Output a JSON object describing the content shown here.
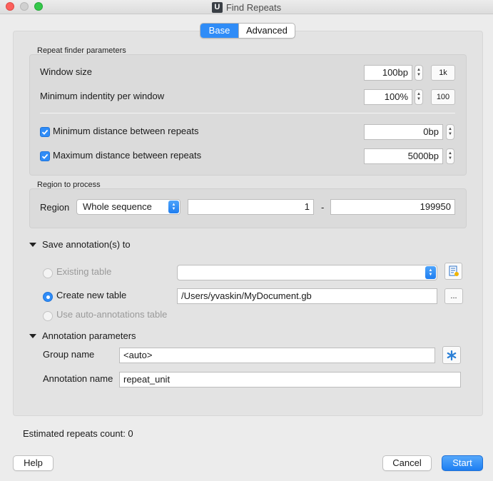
{
  "window": {
    "title": "Find Repeats",
    "app_icon_letter": "U"
  },
  "tabs": [
    {
      "label": "Base",
      "active": true
    },
    {
      "label": "Advanced",
      "active": false
    }
  ],
  "repeat_finder": {
    "group_title": "Repeat finder parameters",
    "window_size": {
      "label": "Window size",
      "value": "100bp",
      "button": "1k"
    },
    "min_identity": {
      "label": "Minimum indentity per window",
      "value": "100%",
      "button": "100"
    },
    "min_distance": {
      "label": "Minimum distance between repeats",
      "checked": true,
      "value": "0bp"
    },
    "max_distance": {
      "label": "Maximum distance between repeats",
      "checked": true,
      "value": "5000bp"
    }
  },
  "region": {
    "group_title": "Region to process",
    "label": "Region",
    "selection": "Whole sequence",
    "start": "1",
    "separator": "-",
    "end": "199950"
  },
  "save_annotations": {
    "header": "Save annotation(s) to",
    "existing_table": {
      "label": "Existing table",
      "value": ""
    },
    "create_new_table": {
      "label": "Create new table",
      "value": "/Users/yvaskin/MyDocument.gb",
      "browse": "..."
    },
    "auto_annotations": {
      "label": "Use auto-annotations table"
    }
  },
  "annotation_params": {
    "header": "Annotation parameters",
    "group_name": {
      "label": "Group name",
      "value": "<auto>"
    },
    "annotation_name": {
      "label": "Annotation name",
      "value": "repeat_unit"
    }
  },
  "status": {
    "estimated": "Estimated repeats count: 0"
  },
  "buttons": {
    "help": "Help",
    "cancel": "Cancel",
    "start": "Start"
  },
  "colors": {
    "accent": "#2f8cf7",
    "close": "#fc605c",
    "maximize": "#34c84a"
  },
  "icons": [
    "app-icon",
    "checkmark-icon",
    "stepper-icon",
    "combo-arrow-icon",
    "table-file-icon",
    "asterisk-icon",
    "disclosure-triangle-icon"
  ]
}
